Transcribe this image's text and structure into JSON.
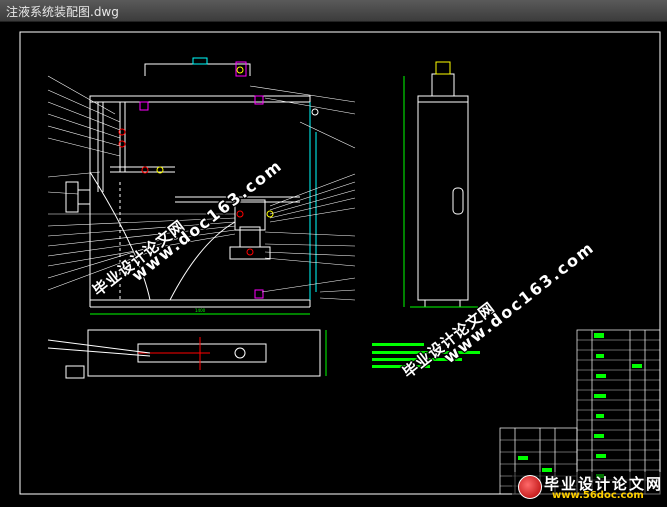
{
  "window": {
    "title": "注液系统装配图.dwg"
  },
  "watermarks": {
    "site_cn": "毕业设计论文网",
    "site_url": "www.doc163.com"
  },
  "footer_logo": {
    "brand": "毕业设计论文网",
    "site": "www.56doc.com"
  },
  "colors": {
    "background": "#000000",
    "line_white": "#ffffff",
    "line_green": "#00ff00",
    "line_cyan": "#00ffff",
    "line_magenta": "#ff00ff",
    "line_red": "#ff0000",
    "line_yellow": "#ffff00"
  }
}
